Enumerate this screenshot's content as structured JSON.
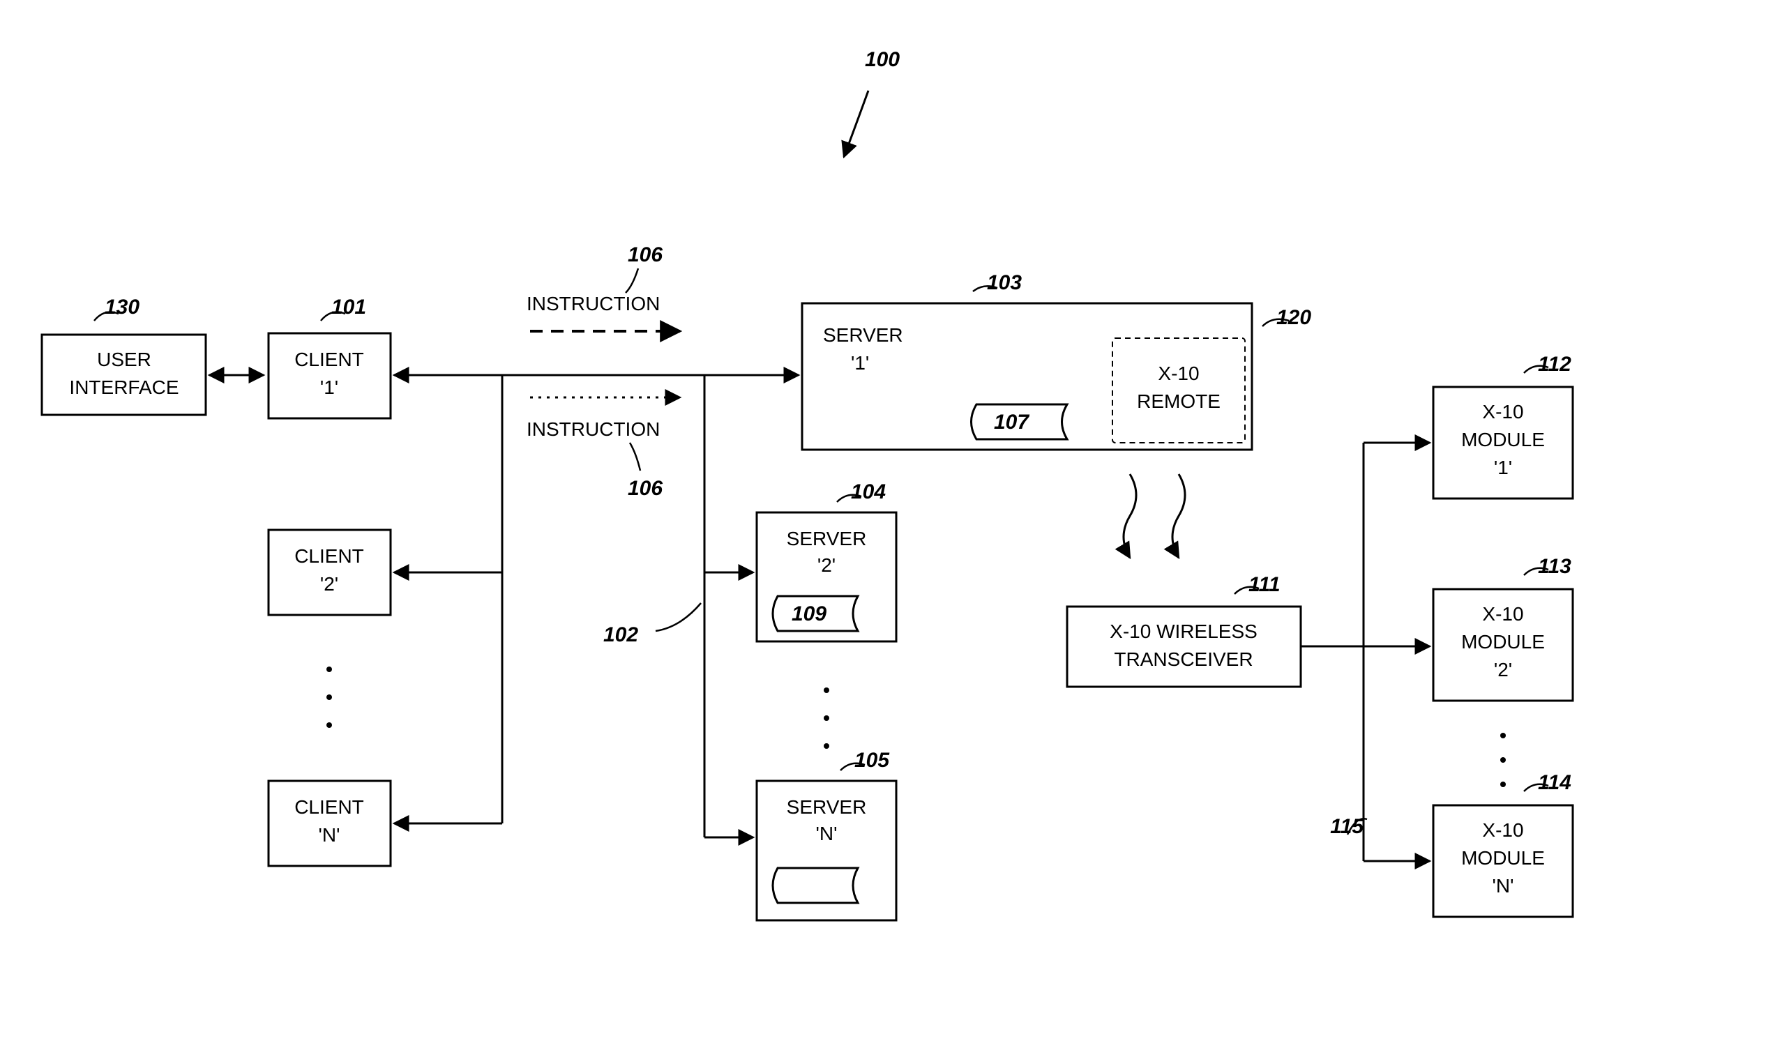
{
  "diagram": {
    "figure_id": "100",
    "user_interface": {
      "line1": "USER",
      "line2": "INTERFACE",
      "ref": "130"
    },
    "clients": [
      {
        "line1": "CLIENT",
        "line2": "'1'",
        "ref": "101"
      },
      {
        "line1": "CLIENT",
        "line2": "'2'"
      },
      {
        "line1": "CLIENT",
        "line2": "'N'"
      }
    ],
    "instruction_upper": {
      "text": "INSTRUCTION",
      "ref": "106"
    },
    "instruction_lower": {
      "text": "INSTRUCTION",
      "ref": "106"
    },
    "bus_ref": "102",
    "servers": [
      {
        "line1": "SERVER",
        "line2": "'1'",
        "ref": "103",
        "inner_ref": "107"
      },
      {
        "line1": "SERVER",
        "line2": "'2'",
        "ref": "104",
        "inner_ref": "109"
      },
      {
        "line1": "SERVER",
        "line2": "'N'",
        "ref": "105"
      }
    ],
    "x10_remote": {
      "line1": "X-10",
      "line2": "REMOTE",
      "ref": "120"
    },
    "x10_transceiver": {
      "line1": "X-10 WIRELESS",
      "line2": "TRANSCEIVER",
      "ref": "111"
    },
    "x10_modules": [
      {
        "line1": "X-10",
        "line2": "MODULE",
        "line3": "'1'",
        "ref": "112"
      },
      {
        "line1": "X-10",
        "line2": "MODULE",
        "line3": "'2'",
        "ref": "113"
      },
      {
        "line1": "X-10",
        "line2": "MODULE",
        "line3": "'N'",
        "ref": "114"
      }
    ],
    "module_bus_ref": "115"
  }
}
